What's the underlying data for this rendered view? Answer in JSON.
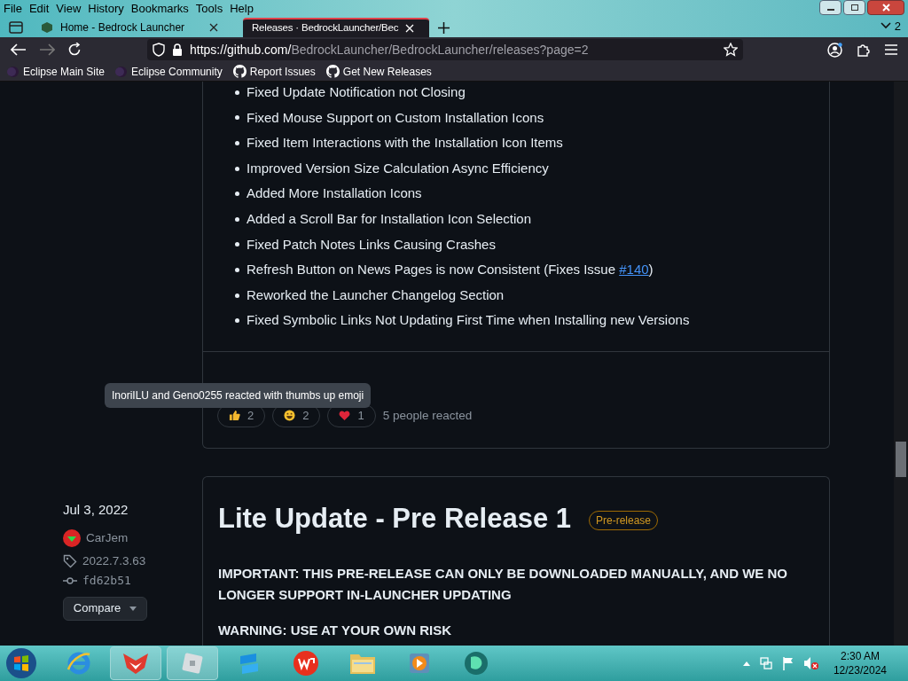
{
  "menu_bar": [
    "File",
    "Edit",
    "View",
    "History",
    "Bookmarks",
    "Tools",
    "Help"
  ],
  "tabs": [
    {
      "title": "Home - Bedrock Launcher",
      "selected": false
    },
    {
      "title": "Releases · BedrockLauncher/Bec",
      "selected": true
    }
  ],
  "tab_count": "2",
  "address": {
    "host": "https://github.com/",
    "path": "BedrockLauncher/BedrockLauncher/releases?page=2"
  },
  "bookmarks": [
    {
      "label": "Eclipse Main Site",
      "kind": "moon"
    },
    {
      "label": "Eclipse Community",
      "kind": "moon"
    },
    {
      "label": "Report Issues",
      "kind": "github"
    },
    {
      "label": "Get New Releases",
      "kind": "github"
    }
  ],
  "release_notes": [
    {
      "text": "Fixed Update Notification not Closing"
    },
    {
      "text": "Fixed Mouse Support on Custom Installation Icons"
    },
    {
      "text": "Fixed Item Interactions with the Installation Icon Items"
    },
    {
      "text": "Improved Version Size Calculation Async Efficiency"
    },
    {
      "text": "Added More Installation Icons"
    },
    {
      "text": "Added a Scroll Bar for Installation Icon Selection"
    },
    {
      "text": "Fixed Patch Notes Links Causing Crashes"
    },
    {
      "text": "Refresh Button on News Pages is now Consistent (Fixes Issue ",
      "link": "#140",
      "after": ")"
    },
    {
      "text": "Reworked the Launcher Changelog Section"
    },
    {
      "text": "Fixed Symbolic Links Not Updating First Time when Installing new Versions"
    }
  ],
  "tooltip": "InoriILU and Geno0255 reacted with thumbs up emoji",
  "reactions": [
    {
      "kind": "thumbs",
      "count": "2"
    },
    {
      "kind": "smile",
      "count": "2"
    },
    {
      "kind": "heart",
      "count": "1"
    }
  ],
  "reaction_summary": "5 people reacted",
  "next_release": {
    "date": "Jul 3, 2022",
    "author": "CarJem",
    "tag": "2022.7.3.63",
    "commit": "fd62b51",
    "compare": "Compare",
    "title": "Lite Update - Pre Release 1",
    "badge": "Pre-release",
    "paragraphs": [
      "IMPORTANT: THIS PRE-RELEASE CAN ONLY BE DOWNLOADED MANUALLY, AND WE NO LONGER SUPPORT IN-LAUNCHER UPDATING",
      "WARNING: USE AT YOUR OWN RISK"
    ]
  },
  "taskbar": {
    "apps": [
      {
        "kind": "ie",
        "selected": false
      },
      {
        "kind": "fox",
        "selected": true
      },
      {
        "kind": "cube",
        "selected": true
      },
      {
        "kind": "blue",
        "selected": false
      },
      {
        "kind": "wps",
        "selected": false
      },
      {
        "kind": "folder",
        "selected": false
      },
      {
        "kind": "player",
        "selected": false
      },
      {
        "kind": "circle",
        "selected": false
      }
    ],
    "time": "2:30 AM",
    "date": "12/23/2024"
  }
}
